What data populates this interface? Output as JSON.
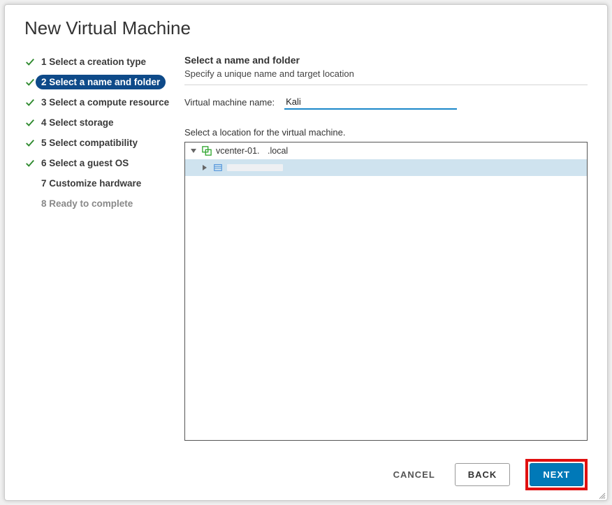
{
  "dialog": {
    "title": "New Virtual Machine"
  },
  "steps": [
    {
      "num": "1",
      "label": "1 Select a creation type",
      "state": "done"
    },
    {
      "num": "2",
      "label": "2 Select a name and folder",
      "state": "active"
    },
    {
      "num": "3",
      "label": "3 Select a compute resource",
      "state": "done"
    },
    {
      "num": "4",
      "label": "4 Select storage",
      "state": "done"
    },
    {
      "num": "5",
      "label": "5 Select compatibility",
      "state": "done"
    },
    {
      "num": "6",
      "label": "6 Select a guest OS",
      "state": "done"
    },
    {
      "num": "7",
      "label": "7 Customize hardware",
      "state": "pending"
    },
    {
      "num": "8",
      "label": "8 Ready to complete",
      "state": "disabled"
    }
  ],
  "main": {
    "section_title": "Select a name and folder",
    "section_sub": "Specify a unique name and target location",
    "vm_name_label": "Virtual machine name:",
    "vm_name_value": "Kali",
    "location_caption": "Select a location for the virtual machine.",
    "tree": {
      "root_segments": [
        "vcenter-01.",
        ".local"
      ],
      "child_label": ""
    }
  },
  "footer": {
    "cancel": "CANCEL",
    "back": "BACK",
    "next": "NEXT"
  }
}
